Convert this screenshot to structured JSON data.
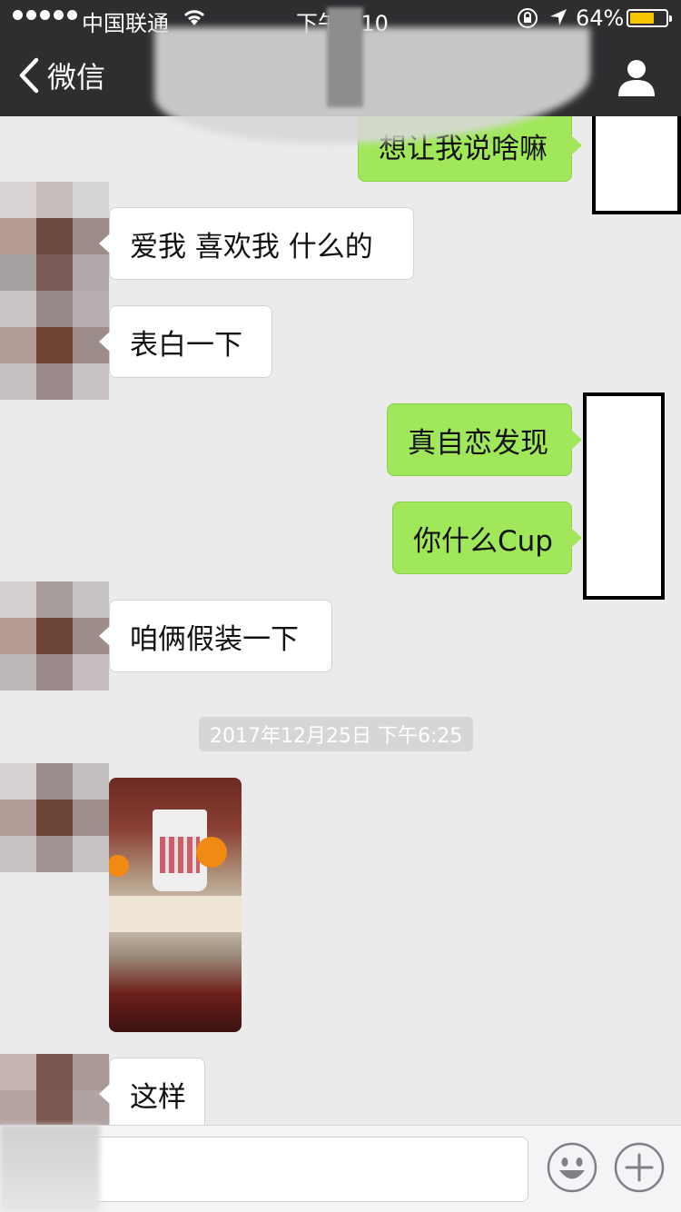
{
  "status_bar": {
    "carrier": "中国联通",
    "time": "下午8:10",
    "battery_percent": "64%",
    "battery_level": 0.64,
    "icons": [
      "signal-dots-icon",
      "wifi-icon",
      "orientation-lock-icon",
      "location-arrow-icon",
      "battery-icon"
    ]
  },
  "nav": {
    "back_label": "微信",
    "icons": [
      "chevron-left-icon",
      "profile-icon"
    ]
  },
  "messages": [
    {
      "side": "out",
      "text": "想让我说啥嘛"
    },
    {
      "side": "in",
      "text": "爱我 喜欢我 什么的"
    },
    {
      "side": "in",
      "text": "表白一下"
    },
    {
      "side": "out",
      "text": "真自恋发现"
    },
    {
      "side": "out",
      "text": "你什么Cup"
    },
    {
      "side": "in",
      "text": "咱俩假装一下"
    },
    {
      "side": "in",
      "type": "image"
    },
    {
      "side": "in",
      "text": "这样"
    }
  ],
  "timestamp": "2017年12月25日 下午6:25",
  "input_bar": {
    "icons": [
      "emoji-icon",
      "plus-icon"
    ]
  },
  "colors": {
    "nav_bg": "#2e2e31",
    "chat_bg": "#ebebeb",
    "outgoing_bubble": "#a0e75a",
    "incoming_bubble": "#ffffff",
    "battery": "#f7c500"
  }
}
